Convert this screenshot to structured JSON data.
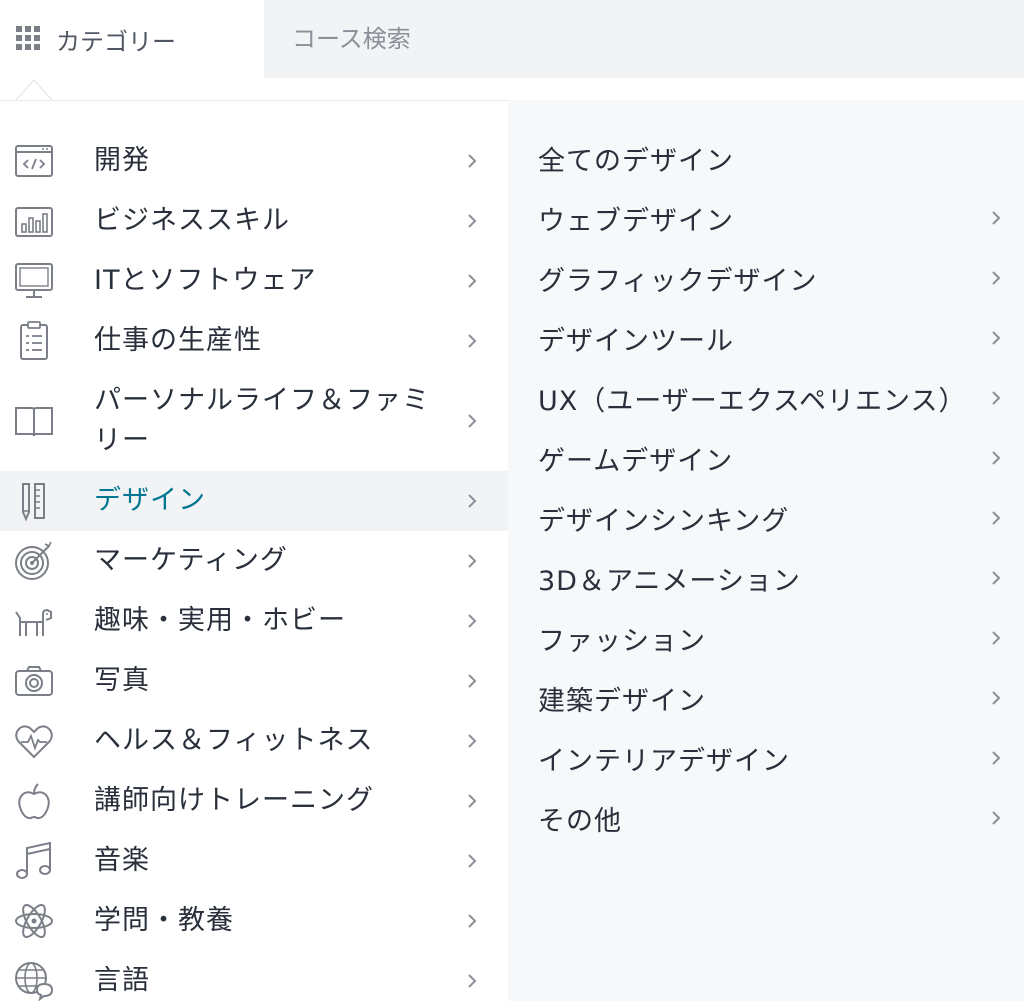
{
  "header": {
    "category_label": "カテゴリー",
    "search_placeholder": "コース検索"
  },
  "categories": [
    {
      "label": "開発",
      "icon": "code-window-icon"
    },
    {
      "label": "ビジネススキル",
      "icon": "bar-chart-icon"
    },
    {
      "label": "ITとソフトウェア",
      "icon": "monitor-icon"
    },
    {
      "label": "仕事の生産性",
      "icon": "clipboard-icon"
    },
    {
      "label": "パーソナルライフ＆ファミ",
      "label2": "リー",
      "icon": "open-book-icon"
    },
    {
      "label": "デザイン",
      "icon": "ruler-pencil-icon",
      "active": true
    },
    {
      "label": "マーケティング",
      "icon": "target-icon"
    },
    {
      "label": "趣味・実用・ホビー",
      "icon": "dog-icon"
    },
    {
      "label": "写真",
      "icon": "camera-icon"
    },
    {
      "label": "ヘルス＆フィットネス",
      "icon": "heart-pulse-icon"
    },
    {
      "label": "講師向けトレーニング",
      "icon": "apple-icon"
    },
    {
      "label": "音楽",
      "icon": "music-note-icon"
    },
    {
      "label": "学問・教養",
      "icon": "atom-icon"
    },
    {
      "label": "言語",
      "icon": "globe-chat-icon"
    }
  ],
  "subcategories": [
    {
      "label": "全てのデザイン",
      "chevron": false
    },
    {
      "label": "ウェブデザイン",
      "chevron": true
    },
    {
      "label": "グラフィックデザイン",
      "chevron": true
    },
    {
      "label": "デザインツール",
      "chevron": true
    },
    {
      "label": "UX（ユーザーエクスペリエンス）",
      "chevron": true
    },
    {
      "label": "ゲームデザイン",
      "chevron": true
    },
    {
      "label": "デザインシンキング",
      "chevron": true
    },
    {
      "label": "3D＆アニメーション",
      "chevron": true
    },
    {
      "label": "ファッション",
      "chevron": true
    },
    {
      "label": "建築デザイン",
      "chevron": true
    },
    {
      "label": "インテリアデザイン",
      "chevron": true
    },
    {
      "label": "その他",
      "chevron": true
    }
  ],
  "colors": {
    "active_text": "#007791",
    "text": "#29303b",
    "icon": "#7b7f87",
    "active_bg": "#f2f3f5",
    "right_bg": "#f7f8fa"
  }
}
